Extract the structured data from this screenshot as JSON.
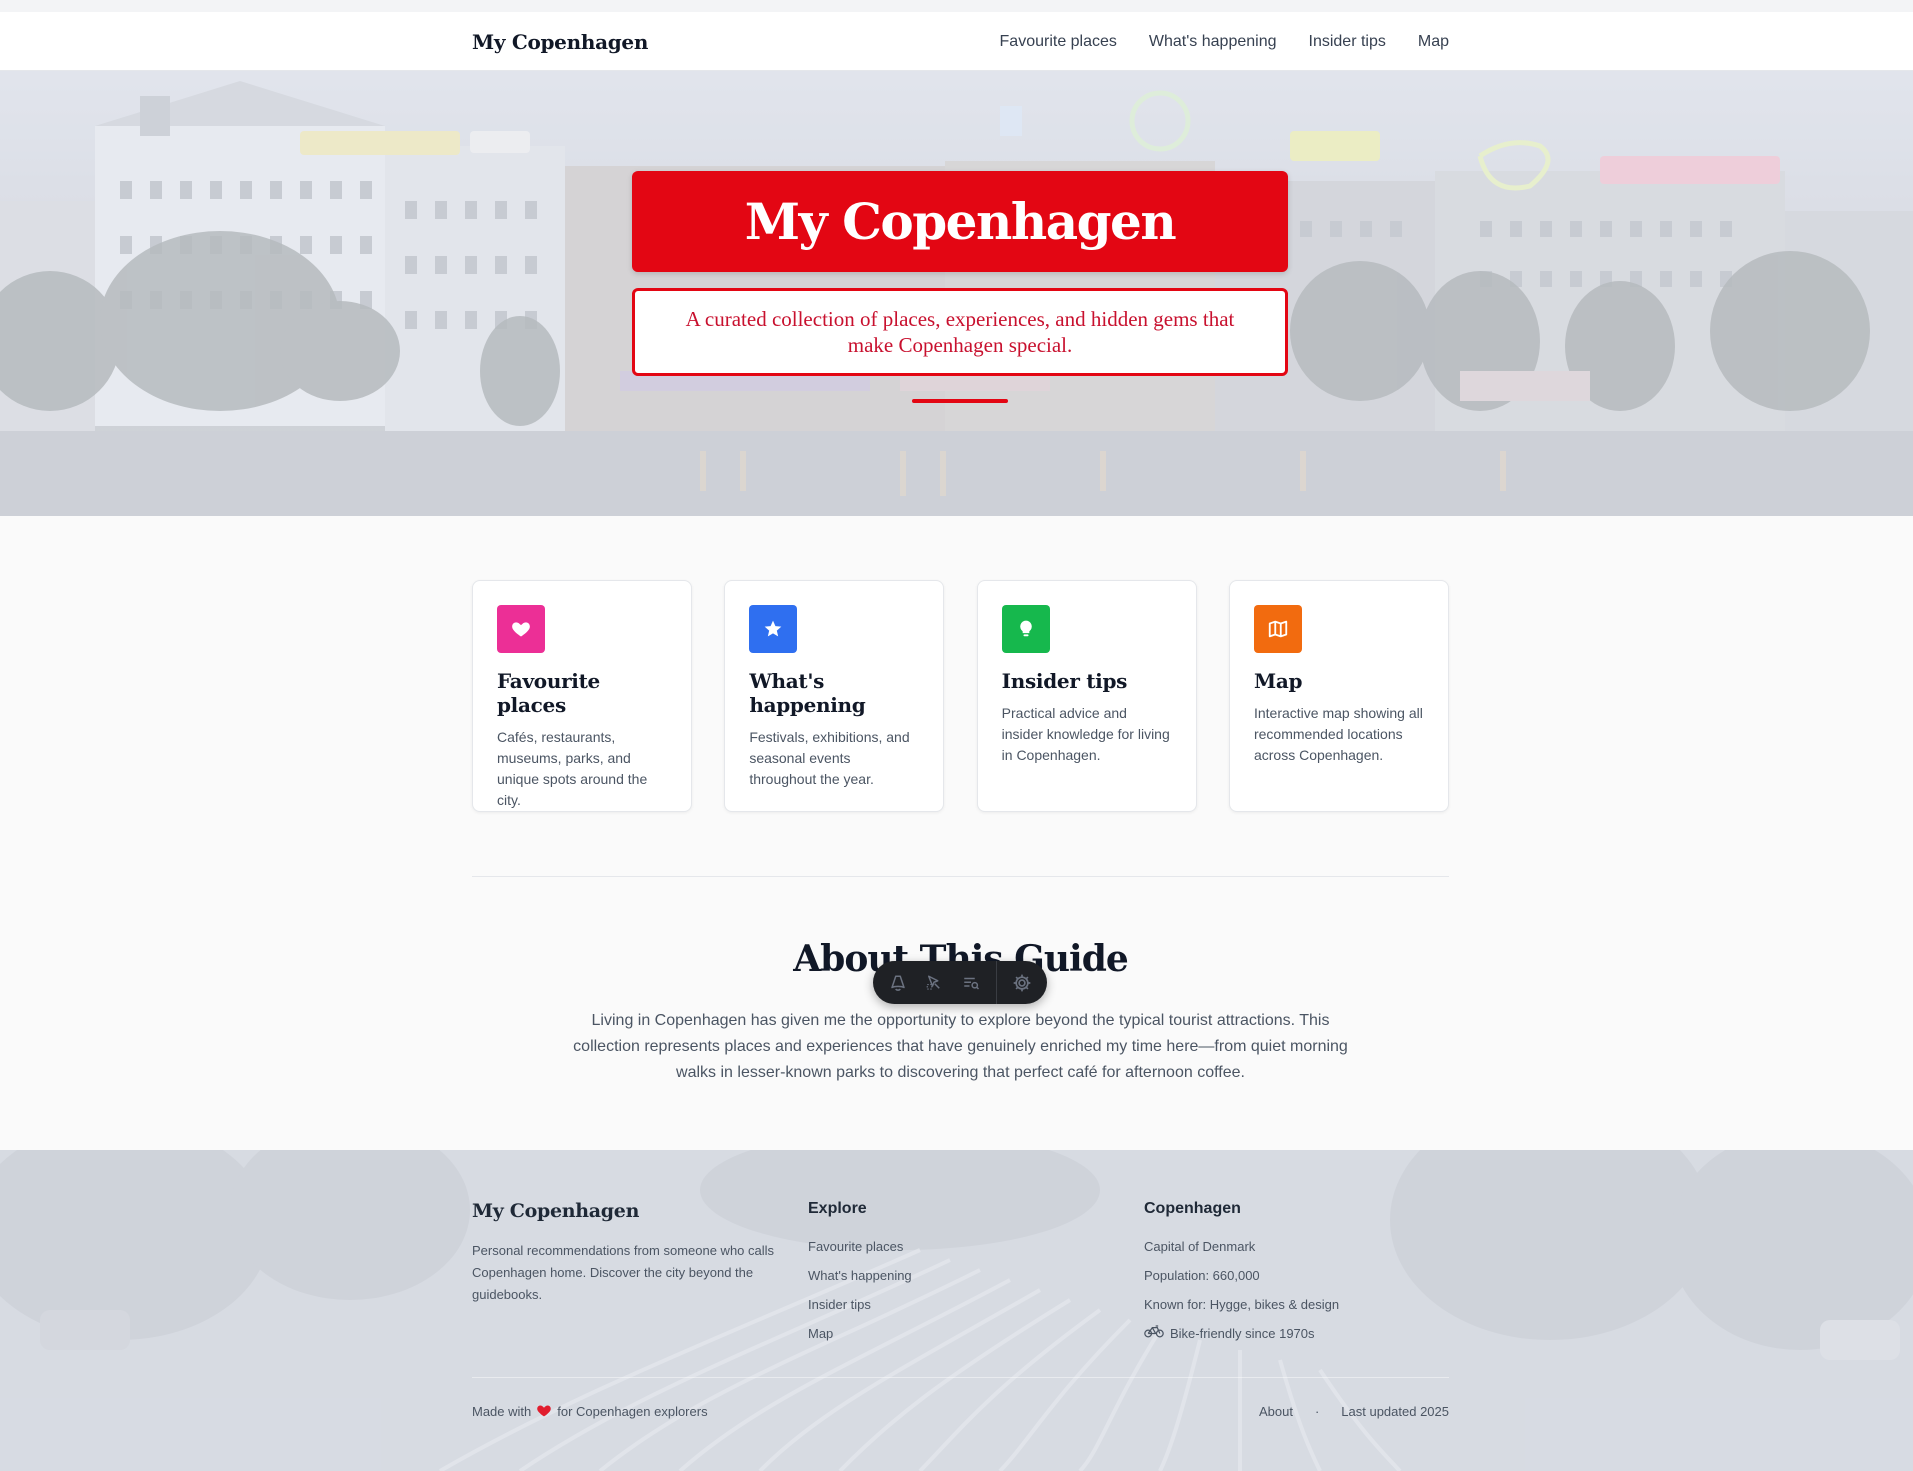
{
  "nav": {
    "brand": "My Copenhagen",
    "links": [
      "Favourite places",
      "What's happening",
      "Insider tips",
      "Map"
    ]
  },
  "hero": {
    "title": "My Copenhagen",
    "subtitle": "A curated collection of places, experiences, and hidden gems that make Copenhagen special.",
    "accent_color": "#e30613"
  },
  "cards": [
    {
      "title": "Favourite places",
      "desc": "Cafés, restaurants, museums, parks, and unique spots around the city.",
      "icon": "heart-icon",
      "color": "#ec2f96"
    },
    {
      "title": "What's happening",
      "desc": "Festivals, exhibitions, and seasonal events throughout the year.",
      "icon": "star-icon",
      "color": "#2f6ff0"
    },
    {
      "title": "Insider tips",
      "desc": "Practical advice and insider knowledge for living in Copenhagen.",
      "icon": "lightbulb-icon",
      "color": "#16b84d"
    },
    {
      "title": "Map",
      "desc": "Interactive map showing all recommended locations across Copenhagen.",
      "icon": "map-icon",
      "color": "#f26b0f"
    }
  ],
  "about": {
    "title": "About This Guide",
    "text": "Living in Copenhagen has given me the opportunity to explore beyond the typical tourist attractions. This collection represents places and experiences that have genuinely enriched my time here—from quiet morning walks in lesser-known parks to discovering that perfect café for afternoon coffee."
  },
  "toolbar": {
    "icons": [
      "astro-icon",
      "cursor-inspect-icon",
      "audit-list-icon",
      "settings-gear-icon"
    ]
  },
  "footer": {
    "brand": "My Copenhagen",
    "desc": "Personal recommendations from someone who calls Copenhagen home. Discover the city beyond the guidebooks.",
    "explore": {
      "heading": "Explore",
      "links": [
        "Favourite places",
        "What's happening",
        "Insider tips",
        "Map"
      ]
    },
    "city": {
      "heading": "Copenhagen",
      "facts": [
        "Capital of Denmark",
        "Population: 660,000",
        "Known for: Hygge, bikes & design",
        "Bike-friendly since 1970s"
      ]
    },
    "made_with_prefix": "Made with",
    "made_with_suffix": "for Copenhagen explorers",
    "about_link": "About",
    "separator": "·",
    "last_updated": "Last updated 2025"
  }
}
